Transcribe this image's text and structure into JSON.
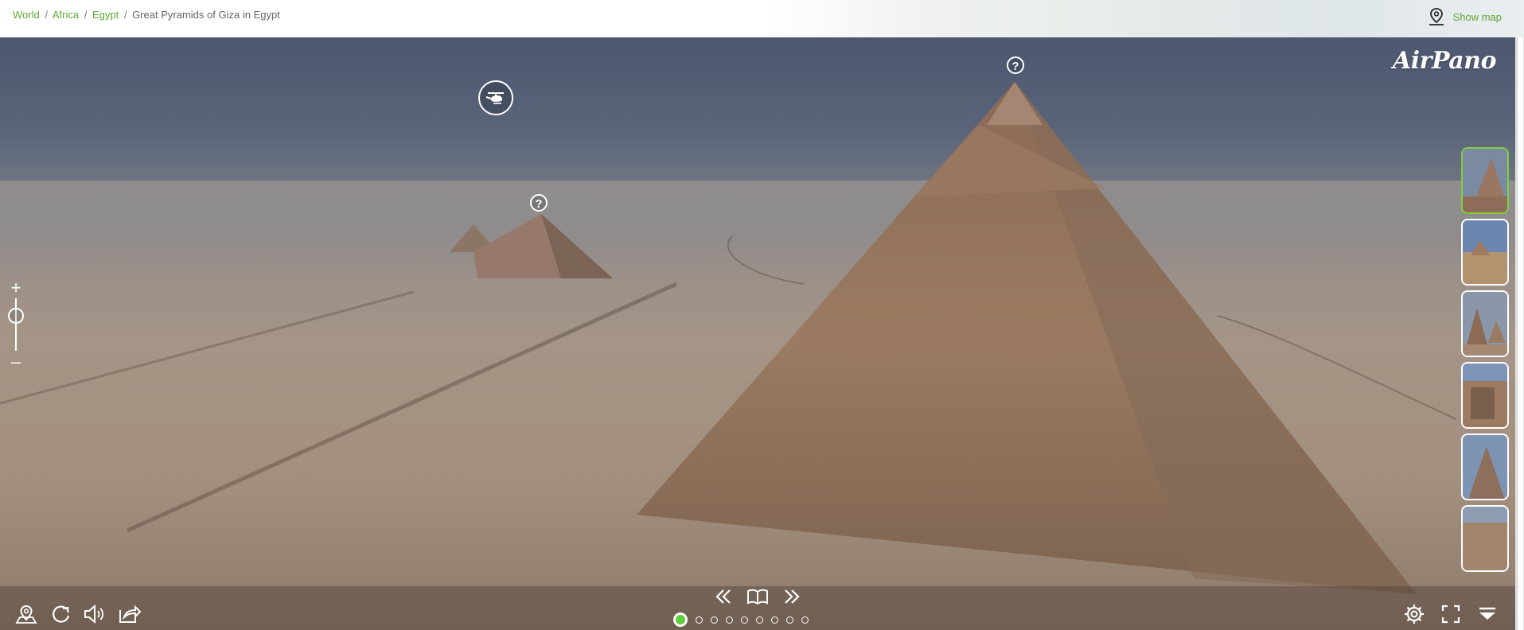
{
  "breadcrumb": {
    "items": [
      "World",
      "Africa",
      "Egypt"
    ],
    "current": "Great Pyramids of Giza in Egypt",
    "separator": "/"
  },
  "header": {
    "show_map_label": "Show map"
  },
  "logo": {
    "text": "AirPano"
  },
  "hotspots": [
    {
      "label": "?"
    },
    {
      "label": "?"
    }
  ],
  "zoom": {
    "plus": "+",
    "minus": "–"
  },
  "panorama_dots": {
    "count": 9,
    "active_index": 0
  },
  "thumbnails": {
    "count": 6,
    "active_index": 0
  },
  "icons": {
    "top_right": "map-pin-icon",
    "center_nav": [
      "double-chevron-left-icon",
      "book-icon",
      "double-chevron-right-icon"
    ],
    "bottom_left": [
      "map-pin-icon",
      "rotate-icon",
      "speaker-icon",
      "share-icon"
    ],
    "bottom_right": [
      "gear-icon",
      "fullscreen-icon",
      "collapse-icon"
    ],
    "aerial_marker": "helicopter-icon"
  },
  "colors": {
    "accent_green": "#5fa832",
    "active_dot": "#5fcc3a",
    "active_thumb_border": "#7fd03e"
  }
}
